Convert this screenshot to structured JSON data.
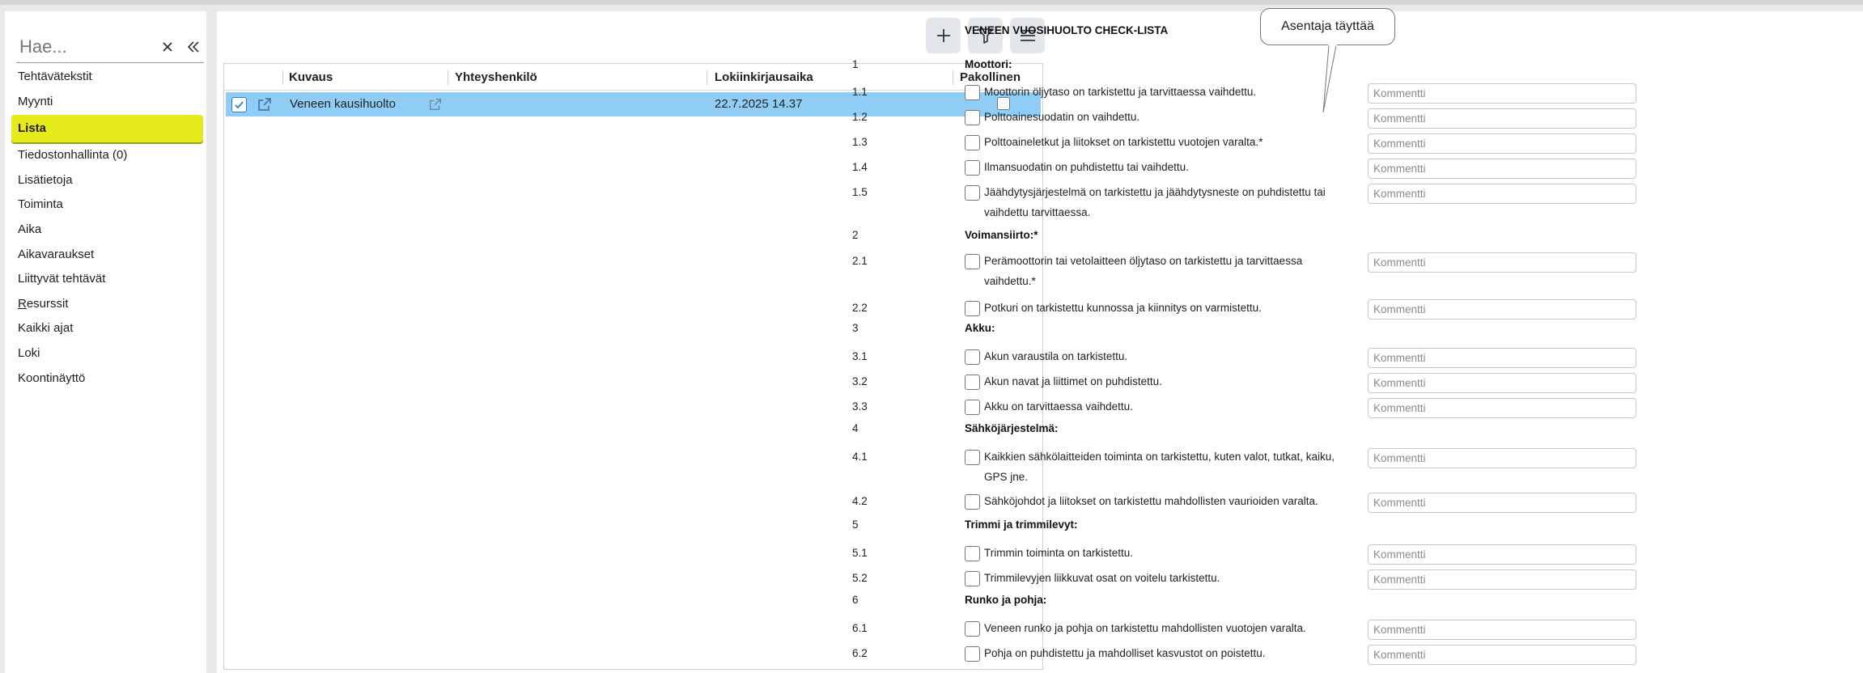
{
  "search": {
    "placeholder": "Hae..."
  },
  "sidebar": {
    "items": [
      {
        "label": "Tehtävätekstit"
      },
      {
        "label": "Myynti"
      },
      {
        "label": "Lista",
        "active": true
      },
      {
        "label": "Tiedostonhallinta (0)"
      },
      {
        "label": "Lisätietoja"
      },
      {
        "label": "Toiminta"
      },
      {
        "label": "Aika"
      },
      {
        "label": "Aikavaraukset"
      },
      {
        "label": "Liittyvät tehtävät"
      },
      {
        "label": "Resurssit",
        "underline_first": true
      },
      {
        "label": "Kaikki ajat"
      },
      {
        "label": "Loki"
      },
      {
        "label": "Koontinäyttö"
      }
    ]
  },
  "toolbar": {
    "add_icon": "plus-icon",
    "filter_icon": "filter-icon",
    "menu_icon": "menu-icon"
  },
  "grid": {
    "columns": [
      "Kuvaus",
      "Yhteyshenkilö",
      "Lokiinkirjausaika",
      "Pakollinen"
    ],
    "rows": [
      {
        "selected": true,
        "kuvaus": "Veneen kausihuolto",
        "yhteyshenkilo": "",
        "lokiinkirjausaika": "22.7.2025 14.37",
        "pakollinen": false
      }
    ]
  },
  "colors": {
    "active_nav": "#e6ea1a",
    "selected_row": "#8fcdf7",
    "toolbar_button": "#e3e6ea"
  },
  "checklist": {
    "title": "VENEEN VUOSIHUOLTO CHECK-LISTA",
    "comment_placeholder": "Kommentti",
    "sections": [
      {
        "number": "1",
        "title": "Moottori:",
        "items": [
          {
            "number": "1.1",
            "text": "Moottorin öljytaso on tarkistettu ja tarvittaessa vaihdettu."
          },
          {
            "number": "1.2",
            "text": "Polttoainesuodatin on vaihdettu."
          },
          {
            "number": "1.3",
            "text": "Polttoaineletkut ja liitokset on tarkistettu vuotojen varalta.*"
          },
          {
            "number": "1.4",
            "text": "Ilmansuodatin on puhdistettu tai vaihdettu."
          },
          {
            "number": "1.5",
            "text": "Jäähdytysjärjestelmä on tarkistettu ja jäähdytysneste on puhdistettu tai vaihdettu tarvittaessa."
          }
        ]
      },
      {
        "number": "2",
        "title": "Voimansiirto:*",
        "items": [
          {
            "number": "2.1",
            "text": "Perämoottorin tai vetolaitteen öljytaso on tarkistettu ja tarvittaessa vaihdettu.*"
          },
          {
            "number": "2.2",
            "text": "Potkuri on tarkistettu kunnossa ja kiinnitys on varmistettu."
          }
        ]
      },
      {
        "number": "3",
        "title": "Akku:",
        "items": [
          {
            "number": "3.1",
            "text": "Akun varaustila on tarkistettu."
          },
          {
            "number": "3.2",
            "text": "Akun navat ja liittimet on puhdistettu."
          },
          {
            "number": "3.3",
            "text": "Akku on tarvittaessa vaihdettu."
          }
        ]
      },
      {
        "number": "4",
        "title": "Sähköjärjestelmä:",
        "items": [
          {
            "number": "4.1",
            "text": "Kaikkien sähkölaitteiden toiminta on tarkistettu, kuten valot, tutkat, kaiku, GPS jne."
          },
          {
            "number": "4.2",
            "text": "Sähköjohdot ja liitokset on tarkistettu mahdollisten vaurioiden varalta."
          }
        ]
      },
      {
        "number": "5",
        "title": "Trimmi ja trimmilevyt:",
        "items": [
          {
            "number": "5.1",
            "text": "Trimmin toiminta on tarkistettu."
          },
          {
            "number": "5.2",
            "text": "Trimmilevyjen liikkuvat osat on voitelu tarkistettu."
          }
        ]
      },
      {
        "number": "6",
        "title": "Runko ja pohja:",
        "items": [
          {
            "number": "6.1",
            "text": "Veneen runko ja pohja on tarkistettu mahdollisten vuotojen varalta."
          },
          {
            "number": "6.2",
            "text": "Pohja on puhdistettu ja mahdolliset kasvustot on poistettu."
          }
        ]
      }
    ]
  },
  "tooltip": {
    "text": "Asentaja täyttää"
  }
}
